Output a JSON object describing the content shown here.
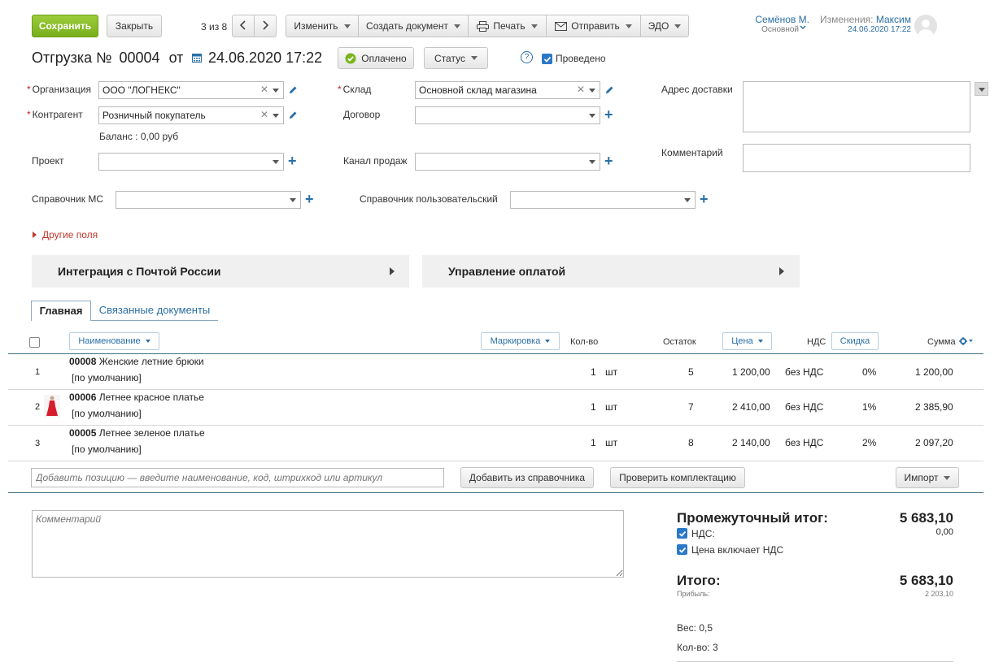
{
  "toolbar": {
    "save": "Сохранить",
    "close": "Закрыть",
    "pager": "3 из 8",
    "edit": "Изменить",
    "create_doc": "Создать документ",
    "print": "Печать",
    "send": "Отправить",
    "edo": "ЭДО"
  },
  "user": {
    "name": "Семёнов М.",
    "role": "Основной",
    "changes_label": "Изменения:",
    "changes_user": "Максим",
    "changes_date": "24.06.2020 17:22"
  },
  "doc": {
    "title": "Отгрузка №",
    "number": "00004",
    "from": "от",
    "datetime": "24.06.2020 17:22",
    "paid": "Оплачено",
    "status": "Статус",
    "help": "?",
    "posted": "Проведено"
  },
  "form": {
    "org_label": "Организация",
    "org_value": "ООО \"ЛОГНЕКС\"",
    "warehouse_label": "Склад",
    "warehouse_value": "Основной склад магазина",
    "address_label": "Адрес доставки",
    "contractor_label": "Контрагент",
    "contractor_value": "Розничный покупатель",
    "contract_label": "Договор",
    "balance": "Баланс : 0,00 руб",
    "project_label": "Проект",
    "channel_label": "Канал продаж",
    "comment_label": "Комментарий",
    "ms_label": "Справочник МС",
    "custom_label": "Справочник пользовательский",
    "other_fields": "Другие поля"
  },
  "panels": {
    "russian_post": "Интеграция с Почтой России",
    "payment": "Управление оплатой"
  },
  "tabs": {
    "main": "Главная",
    "related": "Связанные документы"
  },
  "table": {
    "col_name": "Наименование",
    "col_marking": "Маркировка",
    "col_qty": "Кол-во",
    "col_stock": "Остаток",
    "col_price": "Цена",
    "col_vat": "НДС",
    "col_discount": "Скидка",
    "col_sum": "Сумма",
    "rows": [
      {
        "n": "1",
        "code": "00008",
        "name": "Женские летние брюки",
        "variant": "[по умолчанию]",
        "qty": "1",
        "unit": "шт",
        "stock": "5",
        "price": "1 200,00",
        "vat": "без НДС",
        "discount": "0%",
        "sum": "1 200,00"
      },
      {
        "n": "2",
        "code": "00006",
        "name": "Летнее красное платье",
        "variant": "[по умолчанию]",
        "qty": "1",
        "unit": "шт",
        "stock": "7",
        "price": "2 410,00",
        "vat": "без НДС",
        "discount": "1%",
        "sum": "2 385,90"
      },
      {
        "n": "3",
        "code": "00005",
        "name": "Летнее зеленое платье",
        "variant": "[по умолчанию]",
        "qty": "1",
        "unit": "шт",
        "stock": "8",
        "price": "2 140,00",
        "vat": "без НДС",
        "discount": "2%",
        "sum": "2 097,20"
      }
    ]
  },
  "add": {
    "placeholder": "Добавить позицию — введите наименование, код, штрихкод или артикул",
    "from_catalog": "Добавить из справочника",
    "check_kit": "Проверить комплектацию",
    "import": "Импорт"
  },
  "footer": {
    "comment_placeholder": "Комментарий",
    "subtotal_label": "Промежуточный итог:",
    "subtotal_value": "5 683,10",
    "vat_label": "НДС:",
    "vat_value": "0,00",
    "price_incl_vat": "Цена включает НДС",
    "total_label": "Итого:",
    "total_value": "5 683,10",
    "profit_label": "Прибыль:",
    "profit_value": "2 203,10",
    "weight": "Вес: 0,5",
    "count": "Кол-во: 3"
  },
  "colors": {
    "accent": "#2a6fa5",
    "save_green": "#8cc22e",
    "required": "#cc2222",
    "other_fields": "#c0392b"
  }
}
